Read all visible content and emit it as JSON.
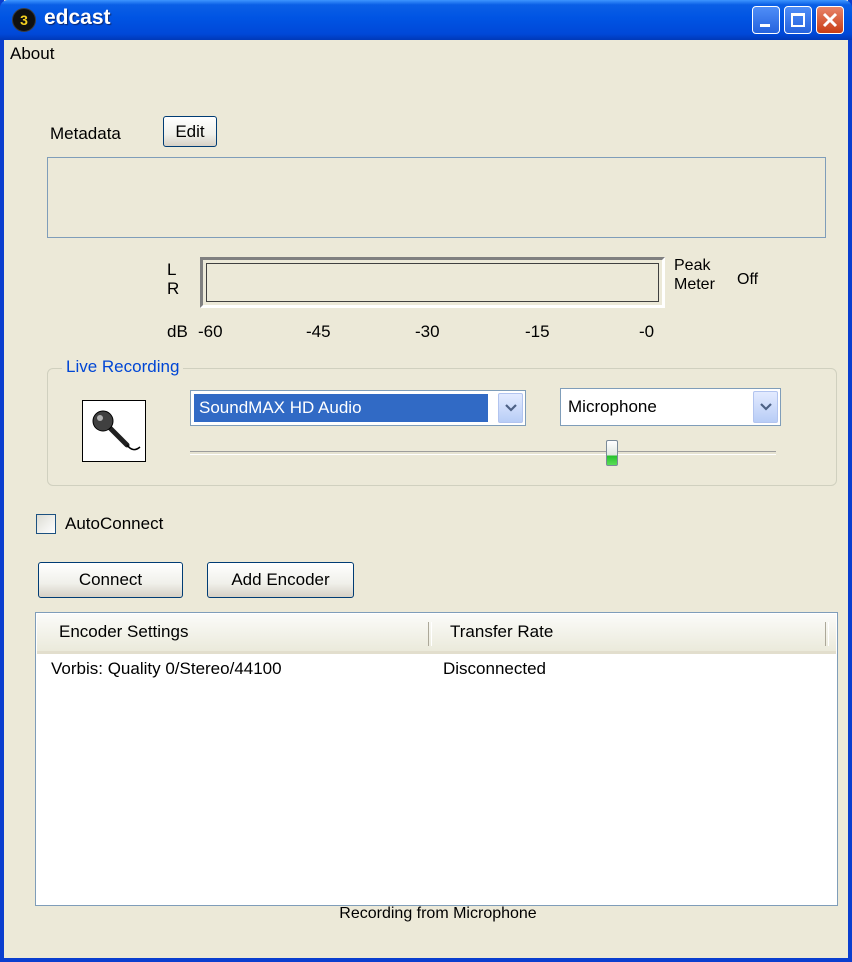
{
  "window": {
    "title": "edcast",
    "app_icon_glyph": "3",
    "title_buttons": [
      "minimize",
      "maximize",
      "close"
    ]
  },
  "menu": {
    "items": [
      "About"
    ]
  },
  "metadata": {
    "label": "Metadata",
    "edit_button": "Edit"
  },
  "meter": {
    "channel_l": "L",
    "channel_r": "R",
    "db_label": "dB",
    "scale": [
      "-60",
      "-45",
      "-30",
      "-15",
      "-0"
    ],
    "peak_label_line1": "Peak",
    "peak_label_line2": "Meter",
    "peak_value": "Off"
  },
  "live_recording": {
    "group_label": "Live Recording",
    "device_select": "SoundMAX HD Audio",
    "source_select": "Microphone",
    "volume_level": 0.72
  },
  "autoconnect": {
    "label": "AutoConnect",
    "checked": false
  },
  "buttons": {
    "connect": "Connect",
    "add_encoder": "Add Encoder"
  },
  "encoders": {
    "columns": [
      "Encoder Settings",
      "Transfer Rate"
    ],
    "rows": [
      {
        "settings": "Vorbis: Quality 0/Stereo/44100",
        "rate": "Disconnected"
      }
    ]
  },
  "status": {
    "text": "Recording from Microphone"
  },
  "colors": {
    "titlebar": "#0054e3",
    "window_bg": "#ece9d8",
    "group_label": "#0046d5",
    "selection": "#316ac5"
  }
}
